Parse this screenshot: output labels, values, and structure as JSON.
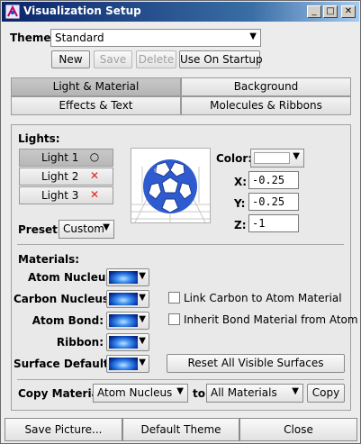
{
  "window": {
    "title": "Visualization Setup",
    "controls": [
      "_",
      "□",
      "✕"
    ]
  },
  "theme": {
    "label": "Theme:",
    "value": "Standard",
    "buttons": {
      "new": "New",
      "save": "Save",
      "delete": "Delete",
      "startup": "Use On Startup"
    }
  },
  "tabs": [
    {
      "label": "Light & Material",
      "active": true
    },
    {
      "label": "Background",
      "active": false
    },
    {
      "label": "Effects & Text",
      "active": false
    },
    {
      "label": "Molecules & Ribbons",
      "active": false
    }
  ],
  "lights": {
    "label": "Lights:",
    "items": [
      {
        "name": "Light 1",
        "state": "on",
        "mark": "○"
      },
      {
        "name": "Light 2",
        "state": "off",
        "mark": "✕"
      },
      {
        "name": "Light 3",
        "state": "off",
        "mark": "✕"
      }
    ],
    "preset_label": "Preset:",
    "preset_value": "Custom"
  },
  "light_props": {
    "color_label": "Color:",
    "x_label": "X:",
    "x_value": "-0.25",
    "y_label": "Y:",
    "y_value": "-0.25",
    "z_label": "Z:",
    "z_value": "-1"
  },
  "materials": {
    "label": "Materials:",
    "rows": [
      {
        "label": "Atom Nucleus:"
      },
      {
        "label": "Carbon Nucleus:"
      },
      {
        "label": "Atom Bond:"
      },
      {
        "label": "Ribbon:"
      },
      {
        "label": "Surface Default:"
      }
    ],
    "link_carbon": "Link Carbon to Atom Material",
    "inherit_bond": "Inherit Bond Material from Atom",
    "reset_button": "Reset All Visible Surfaces"
  },
  "copy": {
    "label": "Copy Material:",
    "from_value": "Atom Nucleus",
    "to_label": "to",
    "to_value": "All Materials",
    "button": "Copy"
  },
  "bottom": {
    "save_picture": "Save Picture...",
    "default_theme": "Default Theme",
    "close": "Close"
  },
  "colors": {
    "title_start": "#0a246a",
    "title_end": "#a6caf0",
    "accent_blue": "#3b8ef0",
    "error_red": "#e02020"
  }
}
